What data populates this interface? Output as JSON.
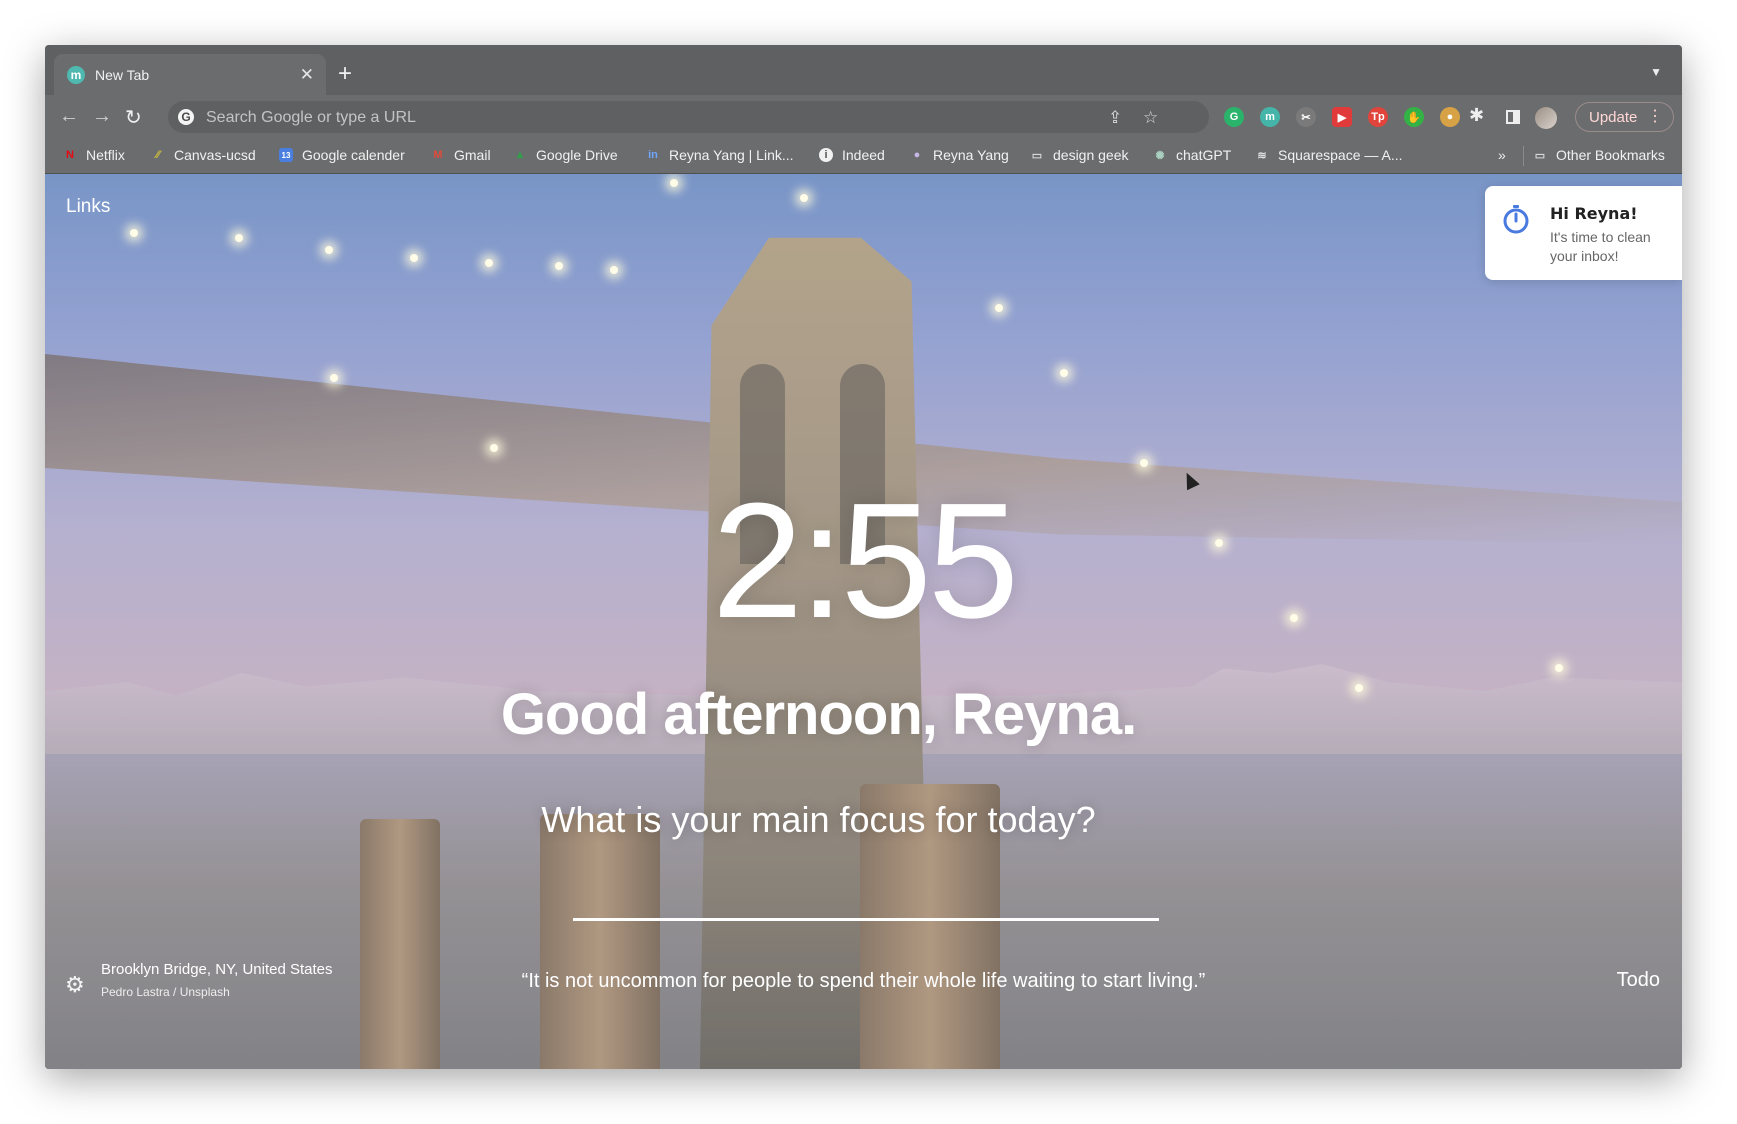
{
  "tab": {
    "title": "New Tab",
    "favicon_letter": "m"
  },
  "toolbar": {
    "omnibox_placeholder": "Search Google or type a URL",
    "google_letter": "G",
    "update_label": "Update"
  },
  "extensions": [
    {
      "letter": "G",
      "color": "#2ab36a"
    },
    {
      "letter": "m",
      "color": "#45b4a9"
    },
    {
      "letter": "✂",
      "color": "#7a7a7a"
    },
    {
      "letter": "▶",
      "color": "#e03a3a"
    },
    {
      "letter": "Tp",
      "color": "#e0443a"
    },
    {
      "letter": "✋",
      "color": "#33b345"
    },
    {
      "letter": "●",
      "color": "#d6a245"
    },
    {
      "letter": "◆",
      "color": "#c04bd2"
    }
  ],
  "bookmarks": [
    {
      "label": "Netflix",
      "icon": "N",
      "color": "#e50914"
    },
    {
      "label": "Canvas-ucsd",
      "icon": "⁄⁄",
      "color": "#d3c23a"
    },
    {
      "label": "Google calender",
      "icon": "13",
      "color": "#4a7fe0"
    },
    {
      "label": "Gmail",
      "icon": "M",
      "color": "#e04a3a"
    },
    {
      "label": "Google Drive",
      "icon": "▲",
      "color": "#2fa04a"
    },
    {
      "label": "Reyna Yang | Link...",
      "icon": "in",
      "color": "#2a6fc0"
    },
    {
      "label": "Indeed",
      "icon": "i",
      "color": "#555555"
    },
    {
      "label": "Reyna Yang",
      "icon": "●",
      "color": "#c7b7e6"
    },
    {
      "label": "design geek",
      "icon": "▭",
      "color": "#777777"
    },
    {
      "label": "chatGPT",
      "icon": "✺",
      "color": "#8fb8a6"
    },
    {
      "label": "Squarespace — A...",
      "icon": "≋",
      "color": "#777777"
    }
  ],
  "bookmarks_more": "»",
  "other_bookmarks": "Other Bookmarks",
  "momentum": {
    "links_label": "Links",
    "toast_title": "Hi Reyna!",
    "toast_body": "It's time to clean your inbox!",
    "time": "2:55",
    "greeting": "Good afternoon, Reyna.",
    "focus_question": "What is your main focus for today?",
    "photo_location": "Brooklyn Bridge, NY, United States",
    "photo_credit": "Pedro Lastra / Unsplash",
    "quote": "“It is not uncommon for people to spend their whole life waiting to start living.”",
    "todo_label": "Todo"
  }
}
